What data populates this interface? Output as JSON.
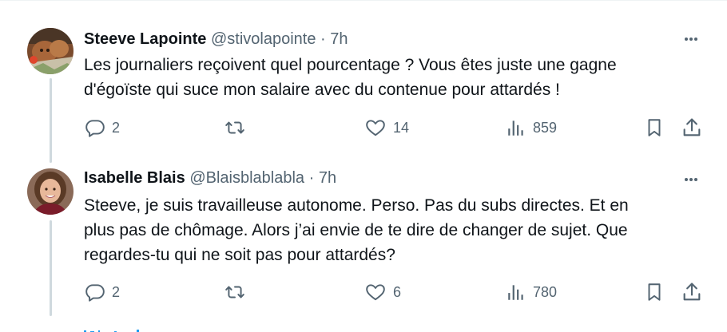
{
  "replies": [
    {
      "author": {
        "display_name": "Steeve Lapointe",
        "handle": "@stivolapointe",
        "separator": "·",
        "time": "7h",
        "avatar": "photo-cat"
      },
      "text_lines": [
        "Les journaliers reçoivent quel pourcentage ?  Vous êtes juste une gagne",
        "d'égoïste qui suce mon salaire avec du contenue pour attardés !"
      ],
      "metrics": {
        "replies": "2",
        "reposts": "",
        "likes": "14",
        "views": "859"
      }
    },
    {
      "author": {
        "display_name": "Isabelle Blais",
        "handle": "@Blaisblablabla",
        "separator": "·",
        "time": "7h",
        "avatar": "photo-woman"
      },
      "text_lines": [
        "Steeve, je suis travailleuse autonome. Perso. Pas du subs directes. Et en",
        "plus pas de chômage. Alors j’ai envie de te dire de changer de sujet. Que",
        "regardes-tu qui ne soit pas pour attardés?"
      ],
      "metrics": {
        "replies": "2",
        "reposts": "",
        "likes": "6",
        "views": "780"
      }
    }
  ],
  "icons": {
    "reply": "reply-icon",
    "repost": "repost-icon",
    "like": "heart-icon",
    "views": "views-icon",
    "bookmark": "bookmark-icon",
    "share": "share-icon",
    "more": "more-icon"
  },
  "colors": {
    "text_primary": "#0f1419",
    "text_secondary": "#536471",
    "thread_line": "#cfd9de",
    "divider": "#eff3f4",
    "link_blue": "#1d9bf0"
  }
}
